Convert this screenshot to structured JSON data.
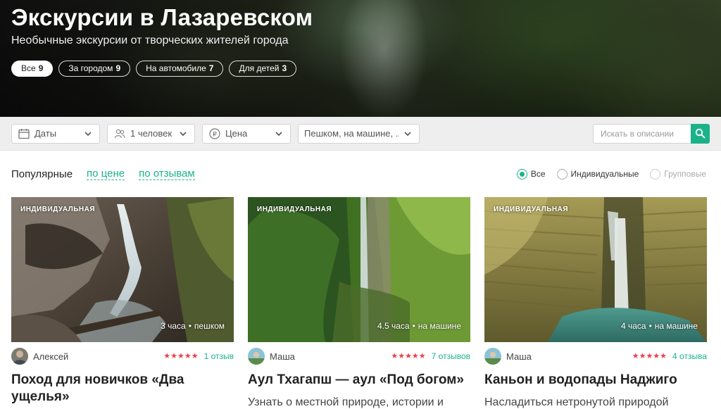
{
  "hero": {
    "title": "Экскурсии в Лазаревском",
    "subtitle": "Необычные экскурсии от творческих жителей города",
    "chips": [
      {
        "label": "Все",
        "count": "9",
        "active": true
      },
      {
        "label": "За городом",
        "count": "9",
        "active": false
      },
      {
        "label": "На автомобиле",
        "count": "7",
        "active": false
      },
      {
        "label": "Для детей",
        "count": "3",
        "active": false
      }
    ]
  },
  "filters": {
    "dates": {
      "label": "Даты",
      "icon": "calendar-icon"
    },
    "people": {
      "label": "1 человек",
      "icon": "people-icon"
    },
    "price": {
      "label": "Цена",
      "icon": "ruble-icon"
    },
    "transport": {
      "label": "Пешком, на машине, ..."
    },
    "search": {
      "placeholder": "Искать в описании",
      "icon": "search-icon"
    }
  },
  "sort": {
    "current": "Популярные",
    "by_price": "по цене",
    "by_reviews": "по отзывам"
  },
  "group_type": {
    "all": "Все",
    "individual": "Индивидуальные",
    "group": "Групповые",
    "selected": "all"
  },
  "cards": [
    {
      "tag": "ИНДИВИДУАЛЬНАЯ",
      "duration": "3 часа",
      "transport": "пешком",
      "author": "Алексей",
      "stars": "★★★★★",
      "reviews": "1 отзыв",
      "title": "Поход для новичков «Два ущелья»",
      "description": ""
    },
    {
      "tag": "ИНДИВИДУАЛЬНАЯ",
      "duration": "4.5 часа",
      "transport": "на машине",
      "author": "Маша",
      "stars": "★★★★★",
      "reviews": "7 отзывов",
      "title": "Аул Тхагапш — аул «Под богом»",
      "description": "Узнать о местной природе, истории и"
    },
    {
      "tag": "ИНДИВИДУАЛЬНАЯ",
      "duration": "4 часа",
      "transport": "на машине",
      "author": "Маша",
      "stars": "★★★★★",
      "reviews": "4 отзыва",
      "title": "Каньон и водопады Наджиго",
      "description": "Насладиться нетронутой природой"
    }
  ],
  "colors": {
    "accent": "#1bb28a",
    "stars": "#e9424d"
  }
}
